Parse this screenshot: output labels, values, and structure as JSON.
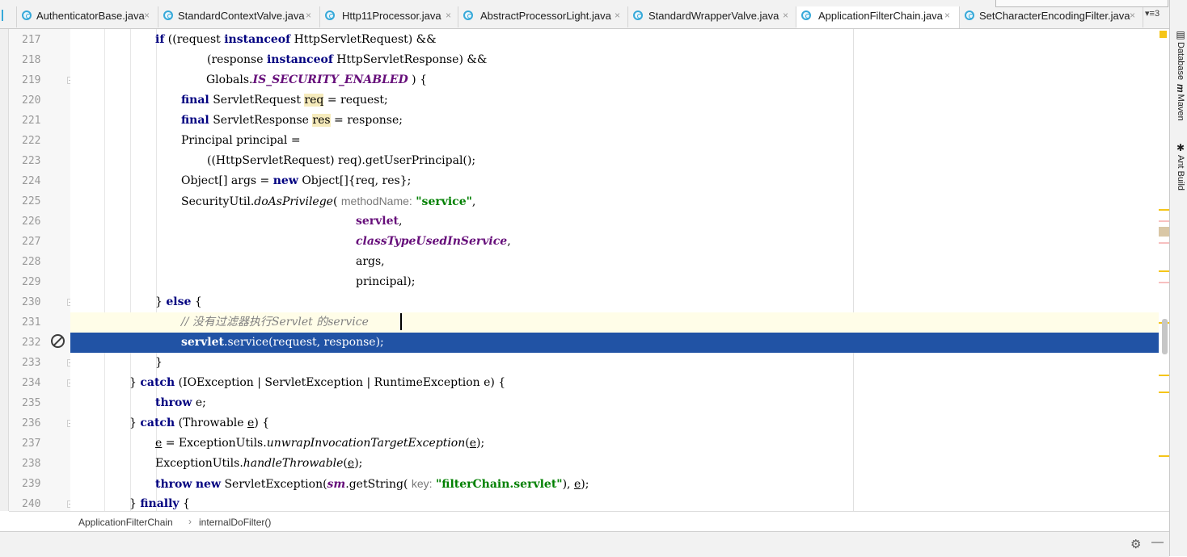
{
  "tabs": [
    {
      "label": "AuthenticatorBase.java",
      "active": false
    },
    {
      "label": "StandardContextValve.java",
      "active": false
    },
    {
      "label": "Http11Processor.java",
      "active": false
    },
    {
      "label": "AbstractProcessorLight.java",
      "active": false
    },
    {
      "label": "StandardWrapperValve.java",
      "active": false
    },
    {
      "label": "ApplicationFilterChain.java",
      "active": true
    },
    {
      "label": "SetCharacterEncodingFilter.java",
      "active": false
    }
  ],
  "tab_close": "×",
  "tab_overflow": "▾≡3",
  "line_numbers": [
    "217",
    "218",
    "219",
    "220",
    "221",
    "222",
    "223",
    "224",
    "225",
    "226",
    "227",
    "228",
    "229",
    "230",
    "231",
    "232",
    "233",
    "234",
    "235",
    "236",
    "237",
    "238",
    "239",
    "240"
  ],
  "code": {
    "l217": [
      "if",
      " ((request ",
      "instanceof",
      " HttpServletRequest) &&"
    ],
    "l218": [
      "(response ",
      "instanceof",
      " HttpServletResponse) &&"
    ],
    "l219": [
      "Globals.",
      "IS_SECURITY_ENABLED",
      " ) {"
    ],
    "l220": [
      "final",
      " ServletRequest ",
      "req",
      " = request;"
    ],
    "l221": [
      "final",
      " ServletResponse ",
      "res",
      " = response;"
    ],
    "l222": [
      "Principal principal ="
    ],
    "l223": [
      "((HttpServletRequest) req).getUserPrincipal();"
    ],
    "l224": [
      "Object[] args = ",
      "new",
      " Object[]{req, res};"
    ],
    "l225": [
      "SecurityUtil.",
      "doAsPrivilege",
      "( ",
      "methodName:",
      " ",
      "\"service\"",
      ","
    ],
    "l226": [
      "servlet",
      ","
    ],
    "l227": [
      "classTypeUsedInService",
      ","
    ],
    "l228": [
      "args,"
    ],
    "l229": [
      "principal);"
    ],
    "l230": [
      "} ",
      "else",
      " {"
    ],
    "l231": [
      "// 没有过滤器执行Servlet 的service"
    ],
    "l232": [
      "servlet",
      ".service(request, response);"
    ],
    "l233": [
      "}"
    ],
    "l234": [
      "} ",
      "catch",
      " (IOException | ServletException | RuntimeException e) {"
    ],
    "l235": [
      "throw",
      " e;"
    ],
    "l236": [
      "} ",
      "catch",
      " (Throwable ",
      "e",
      ") {"
    ],
    "l237": [
      "e",
      " = ExceptionUtils.",
      "unwrapInvocationTargetException",
      "(",
      "e",
      ");"
    ],
    "l238": [
      "ExceptionUtils.",
      "handleThrowable",
      "(",
      "e",
      ");"
    ],
    "l239": [
      "throw",
      " ",
      "new",
      " ServletException(",
      "sm",
      ".getString( ",
      "key:",
      " ",
      "\"filterChain.servlet\"",
      "), ",
      "e",
      ");"
    ],
    "l240": [
      "} ",
      "finally",
      " {"
    ]
  },
  "right_tools": [
    {
      "label": "Database",
      "icon": "database-icon",
      "glyph": "▤"
    },
    {
      "label": "Maven",
      "icon": "maven-icon",
      "glyph": "m"
    },
    {
      "label": "Ant Build",
      "icon": "ant-icon",
      "glyph": "✱"
    }
  ],
  "breadcrumb": {
    "class_name": "ApplicationFilterChain",
    "separator": "›",
    "method_name": "internalDoFilter()"
  },
  "bottom": {
    "gear_glyph": "⚙",
    "minimize_glyph": "—"
  },
  "colors": {
    "keyword": "#000080",
    "string": "#008000",
    "field": "#660e7a",
    "comment": "#808080",
    "selection": "#2153a5",
    "caret_line": "#fffde8"
  }
}
